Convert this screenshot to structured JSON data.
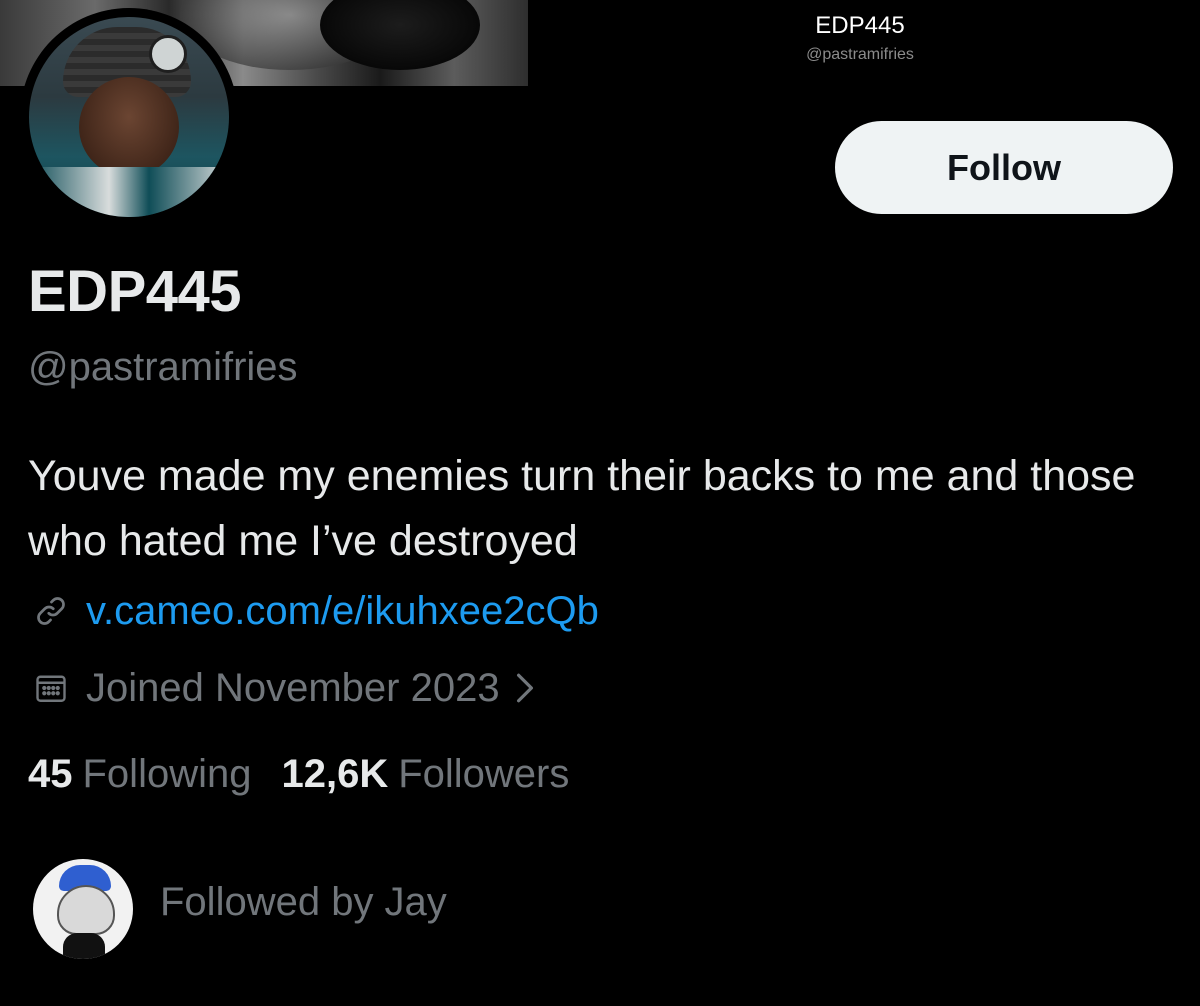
{
  "header": {
    "title": "EDP445",
    "handle": "@pastramifries"
  },
  "profile": {
    "display_name": "EDP445",
    "handle": "@pastramifries",
    "bio": "Youve made my enemies turn their backs to me and those who hated me I’ve destroyed",
    "link": "v.cameo.com/e/ikuhxee2cQb",
    "joined": "Joined November 2023",
    "link_icon": "link-icon",
    "calendar_icon": "calendar-icon"
  },
  "actions": {
    "follow_label": "Follow"
  },
  "stats": {
    "following_count": "45",
    "following_label": "Following",
    "followers_count": "12,6K",
    "followers_label": "Followers"
  },
  "followed_by": {
    "text": "Followed by Jay"
  },
  "colors": {
    "background": "#000000",
    "link": "#1d9bf0",
    "muted": "#71767b",
    "button_bg": "#eff3f4"
  }
}
